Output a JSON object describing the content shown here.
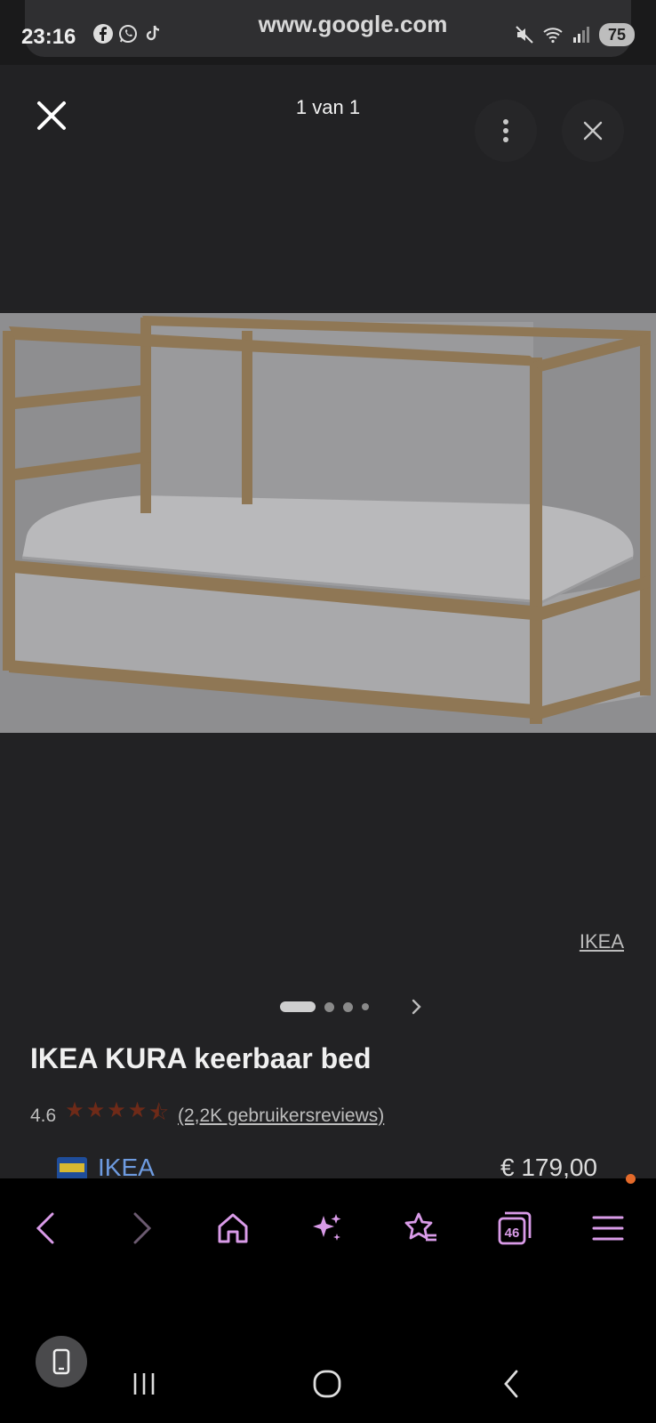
{
  "status": {
    "time": "23:16",
    "url": "www.google.com",
    "battery": "75"
  },
  "viewer": {
    "counter": "1 van 1",
    "source_link": "IKEA"
  },
  "product": {
    "title": "IKEA KURA keerbaar bed",
    "rating": "4.6",
    "stars_value": 4.6,
    "reviews": "(2,2K gebruikersreviews)",
    "offer": {
      "store": "IKEA",
      "price": "€ 179,00"
    }
  },
  "browser_nav": {
    "tabs_count": "46",
    "icons": [
      "back-icon",
      "forward-icon",
      "home-icon",
      "ai-sparkle-icon",
      "bookmarks-icon",
      "tabs-icon",
      "menu-icon"
    ]
  },
  "colors": {
    "background": "#222224",
    "link": "#6e9be0",
    "accent_pink": "#d99be8",
    "star": "#6e2a18",
    "notification": "#e46a2a"
  }
}
